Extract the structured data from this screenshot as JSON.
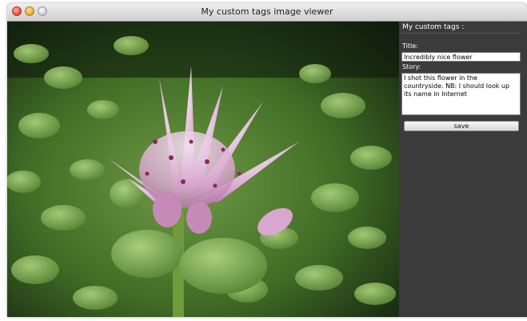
{
  "window": {
    "title": "My custom tags image viewer"
  },
  "sidebar": {
    "header": "My custom tags :",
    "title_label": "Title:",
    "title_value": "Incredibly nice flower",
    "story_label": "Story:",
    "story_value": "I shot this flower in the countryside. NB: I should look up its name in Internet",
    "save_label": "save"
  },
  "colors": {
    "sidebar_bg": "#3b3b3b",
    "close_light": "#e0443a",
    "minimize_light": "#e5a424",
    "zoom_light": "#c8c8c8"
  }
}
